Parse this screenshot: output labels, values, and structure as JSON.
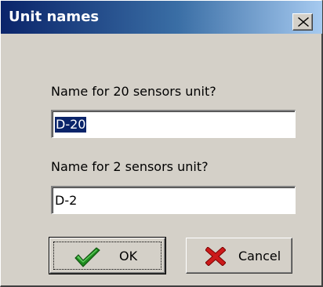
{
  "window": {
    "title": "Unit names",
    "title_bar_colors": [
      "#0a246a",
      "#a6caf0"
    ],
    "close_icon": "close-x-icon"
  },
  "form": {
    "field_20": {
      "label": "Name for 20 sensors unit?",
      "value": "D-20",
      "selected": true
    },
    "field_2": {
      "label": "Name for 2 sensors unit?",
      "value": "D-2"
    }
  },
  "buttons": {
    "ok": {
      "label": "OK",
      "icon": "green-checkmark-icon"
    },
    "cancel": {
      "label": "Cancel",
      "icon": "red-x-icon"
    }
  }
}
